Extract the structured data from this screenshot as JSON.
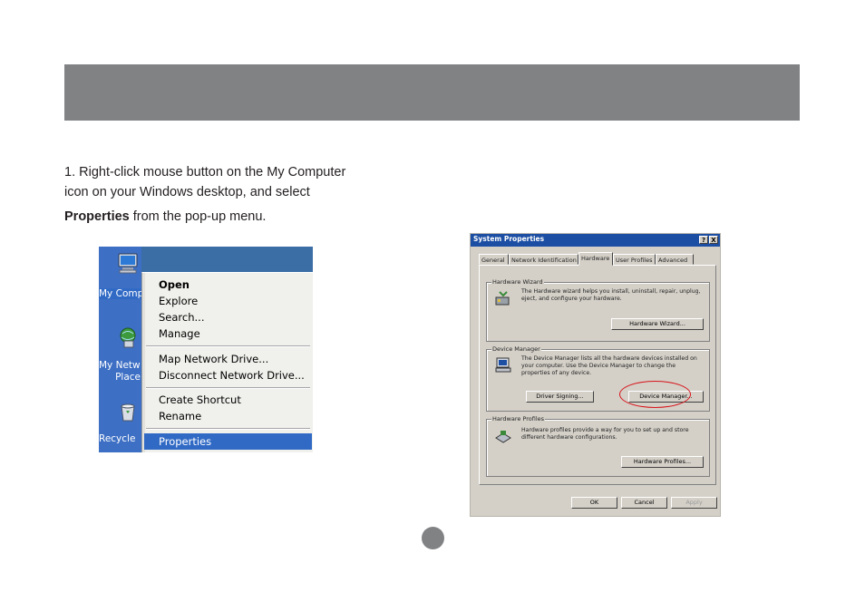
{
  "instruction": {
    "line1": "1. Right-click mouse button on the My Computer",
    "line2": "icon  on your Windows desktop, and select",
    "line3_bold": "Properties",
    "line3_rest": "  from the pop-up menu."
  },
  "desktop": {
    "icons": [
      {
        "label": "My Comp",
        "icon": "my-computer-icon"
      },
      {
        "label": "My Netw",
        "label2": "Place",
        "icon": "network-places-icon"
      },
      {
        "label": "Recycle",
        "icon": "recycle-bin-icon"
      }
    ]
  },
  "context_menu": {
    "items": [
      "Open",
      "Explore",
      "Search...",
      "Manage",
      "Map Network Drive...",
      "Disconnect Network Drive...",
      "Create Shortcut",
      "Rename",
      "Properties"
    ],
    "highlighted": "Properties",
    "highlight_color": "#316ac5"
  },
  "dialog": {
    "title": "System Properties",
    "title_buttons": [
      "?",
      "X"
    ],
    "tabs": [
      "General",
      "Network Identification",
      "Hardware",
      "User Profiles",
      "Advanced"
    ],
    "active_tab": "Hardware",
    "hardware_wizard": {
      "title": "Hardware Wizard",
      "text": "The Hardware wizard helps you install, uninstall, repair, unplug, eject, and configure your hardware.",
      "button": "Hardware Wizard..."
    },
    "device_manager": {
      "title": "Device Manager",
      "text": "The Device Manager lists all the hardware devices installed on your computer. Use the Device Manager to change the properties of any device.",
      "button_signing": "Driver Signing...",
      "button_manager": "Device Manager..."
    },
    "hardware_profiles": {
      "title": "Hardware Profiles",
      "text": "Hardware profiles provide a way for you to set up and store different hardware configurations.",
      "button": "Hardware Profiles..."
    },
    "footer_buttons": [
      "OK",
      "Cancel",
      "Apply"
    ],
    "highlight_circle_color": "#d8141b"
  },
  "colors": {
    "header_bar": "#808284",
    "title_bar": "#1c4ea3"
  }
}
